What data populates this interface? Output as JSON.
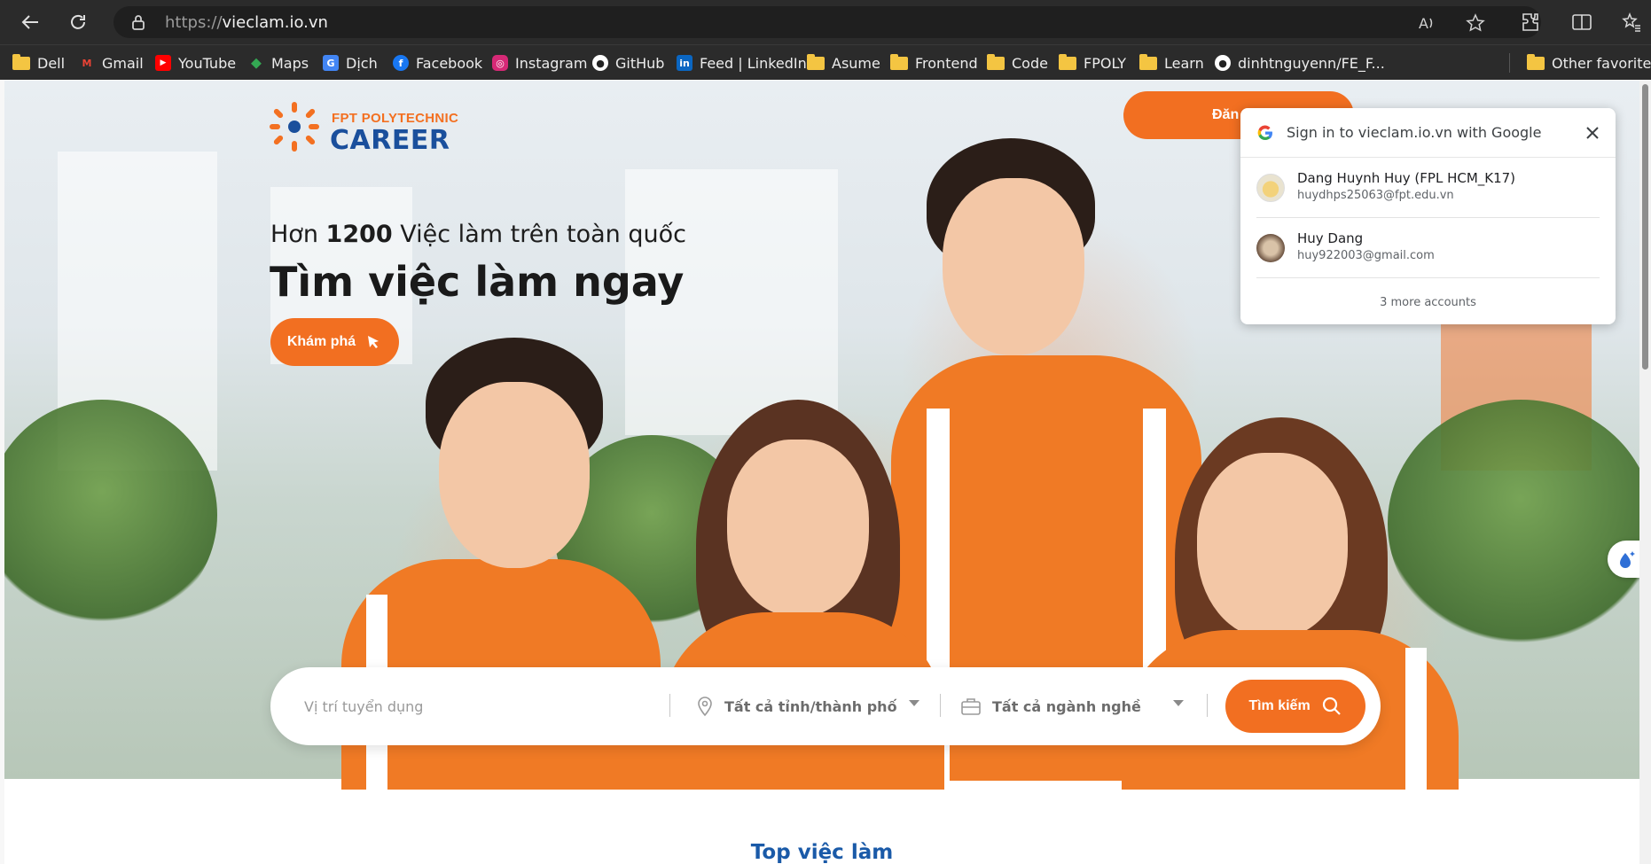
{
  "browser": {
    "url_scheme": "https://",
    "url_host": "vieclam.io.vn",
    "bookmarks": [
      {
        "label": "Dell",
        "icon": "folder-icon"
      },
      {
        "label": "Gmail",
        "icon": "gmail-icon"
      },
      {
        "label": "YouTube",
        "icon": "youtube-icon"
      },
      {
        "label": "Maps",
        "icon": "maps-icon"
      },
      {
        "label": "Dịch",
        "icon": "translate-icon"
      },
      {
        "label": "Facebook",
        "icon": "facebook-icon"
      },
      {
        "label": "Instagram",
        "icon": "instagram-icon"
      },
      {
        "label": "GitHub",
        "icon": "github-icon"
      },
      {
        "label": "Feed | LinkedIn",
        "icon": "linkedin-icon"
      },
      {
        "label": "Asume",
        "icon": "folder-icon"
      },
      {
        "label": "Frontend",
        "icon": "folder-icon"
      },
      {
        "label": "Code",
        "icon": "folder-icon"
      },
      {
        "label": "FPOLY",
        "icon": "folder-icon"
      },
      {
        "label": "Learn",
        "icon": "folder-icon"
      },
      {
        "label": "dinhtnguyenn/FE_F...",
        "icon": "github-icon"
      }
    ],
    "other_favorites": "Other favorites"
  },
  "site": {
    "logo_small": "FPT POLYTECHNIC",
    "logo_big": "CAREER",
    "login_label": "Đăn",
    "hero_sub_prefix": "Hơn ",
    "hero_sub_count": "1200",
    "hero_sub_suffix": " Việc làm trên toàn quốc",
    "hero_title": "Tìm việc làm ngay",
    "explore_label": "Khám phá",
    "search": {
      "placeholder": "Vị trí tuyển dụng",
      "location_value": "Tất cả tỉnh/thành phố",
      "industry_value": "Tất cả ngành nghề",
      "button_label": "Tìm kiếm"
    },
    "section_title": "Top việc làm"
  },
  "google_popup": {
    "title": "Sign in to vieclam.io.vn with Google",
    "accounts": [
      {
        "name": "Dang Huynh Huy (FPL HCM_K17)",
        "email": "huydhps25063@fpt.edu.vn"
      },
      {
        "name": "Huy Dang",
        "email": "huy922003@gmail.com"
      }
    ],
    "more_accounts": "3 more accounts"
  },
  "colors": {
    "brand_orange": "#f26f21",
    "brand_blue": "#1a4f9c",
    "browser_dark": "#2b2b2b"
  }
}
